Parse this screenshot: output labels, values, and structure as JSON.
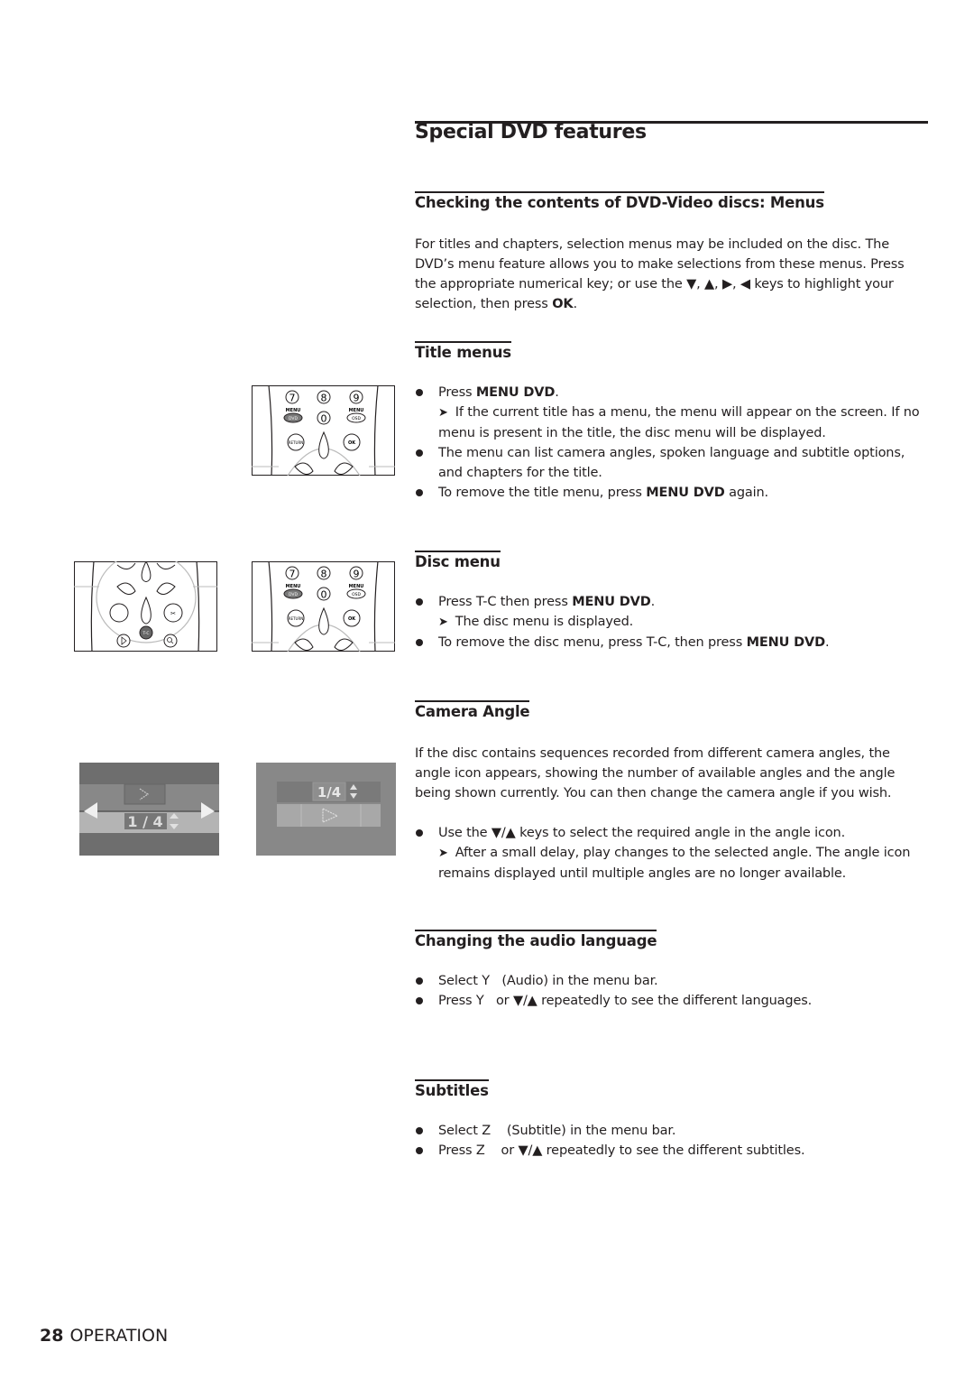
{
  "page": {
    "title": "Special DVD features",
    "footer": {
      "page_number": "28",
      "section": "OPERATION"
    }
  },
  "sections": {
    "menus": {
      "heading": "Checking the contents of DVD-Video discs: Menus",
      "paragraph": "For titles and chapters, selection menus may be included on the disc.   The DVD’s menu feature allows you to make selections from these menus. Press the appropriate numerical key; or use the ▼, ▲, ▶, ◀ keys to highlight your selection, then press",
      "paragraph_bold_end": "OK",
      "paragraph_end": "."
    },
    "title_menus": {
      "heading": "Title menus",
      "items": [
        {
          "pre": "Press ",
          "bold": "MENU DVD",
          "post": ".",
          "sub_arrow": "➤",
          "sub": "If the current title has a menu, the menu will appear on the screen. If no menu is present in the title, the disc menu will be displayed."
        },
        {
          "text": "The menu can list camera angles, spoken language and subtitle options, and chapters for the title."
        },
        {
          "pre": "To remove the title menu, press ",
          "bold": "MENU DVD",
          "post": " again."
        }
      ]
    },
    "disc_menu": {
      "heading": "Disc menu",
      "items": [
        {
          "pre": "Press T-C then press ",
          "bold": "MENU DVD",
          "post": ".",
          "sub_arrow": "➤",
          "sub": "The disc menu is displayed."
        },
        {
          "pre": "To remove the disc menu, press T-C, then press ",
          "bold": "MENU DVD",
          "post": "."
        }
      ]
    },
    "camera_angle": {
      "heading": "Camera Angle",
      "paragraph": "If the disc contains sequences recorded from different camera angles, the angle icon appears, showing the number of available angles and the angle being shown currently. You can then change the camera angle if you wish.",
      "items": [
        {
          "text": "Use the ▼/▲ keys to select the required angle in the angle icon.",
          "sub_arrow": "➤",
          "sub": "After a small delay, play changes to the selected angle. The angle icon remains displayed until multiple angles are no longer available."
        }
      ]
    },
    "audio_language": {
      "heading": "Changing the audio language",
      "items": [
        {
          "text": "Select Y   (Audio) in the menu bar."
        },
        {
          "text": "Press Y   or ▼/▲ repeatedly to see the different languages."
        }
      ]
    },
    "subtitles": {
      "heading": "Subtitles",
      "items": [
        {
          "text": "Select Z    (Subtitle) in the menu bar."
        },
        {
          "text": "Press Z    or ▼/▲ repeatedly to see the different subtitles."
        }
      ]
    }
  },
  "illustrations": {
    "remote_menu": {
      "keys": [
        "7",
        "8",
        "9",
        "0"
      ],
      "menu_label": "MENU",
      "dvd_label": "DVD",
      "osd_label": "OSD",
      "return_label": "RETURN",
      "ok_label": "OK"
    },
    "remote_tc": {
      "tc_label": "T-C"
    },
    "angle_osd": {
      "angle_value": "1 / 4",
      "angle_value_compact": "1/4"
    },
    "colors": {
      "osd_dark": "#6e6e6e",
      "osd_mid": "#8a8a8a",
      "osd_light": "#b4b4b4",
      "highlight_key": "#7a7a7a"
    }
  }
}
